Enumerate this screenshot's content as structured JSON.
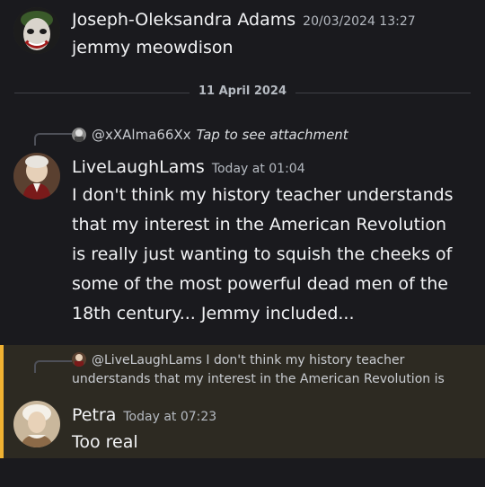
{
  "messages": [
    {
      "author": "Joseph-Oleksandra Adams",
      "timestamp": "20/03/2024 13:27",
      "text": "jemmy meowdison"
    }
  ],
  "date_divider": "11 April 2024",
  "reply1": {
    "to_user": "@xXAlma66Xx",
    "to_text": "Tap to see attachment",
    "author": "LiveLaughLams",
    "timestamp": "Today at 01:04",
    "lines": [
      "I don't think my history teacher understands",
      "that my interest in the American Revolution",
      "is really just wanting to squish the cheeks of",
      "some of the most powerful dead men of the",
      "18th century... Jemmy included..."
    ]
  },
  "reply2": {
    "to_user": "@LiveLaughLams",
    "to_text_line1": "I don't think my history teacher",
    "to_text_line2": "understands that my interest in the American Revolution is",
    "author": "Petra",
    "timestamp": "Today at 07:23",
    "text": "Too real"
  },
  "colors": {
    "background": "#1a1a1e",
    "highlight_bg": "#2d2a22",
    "highlight_border": "#f0b232"
  }
}
